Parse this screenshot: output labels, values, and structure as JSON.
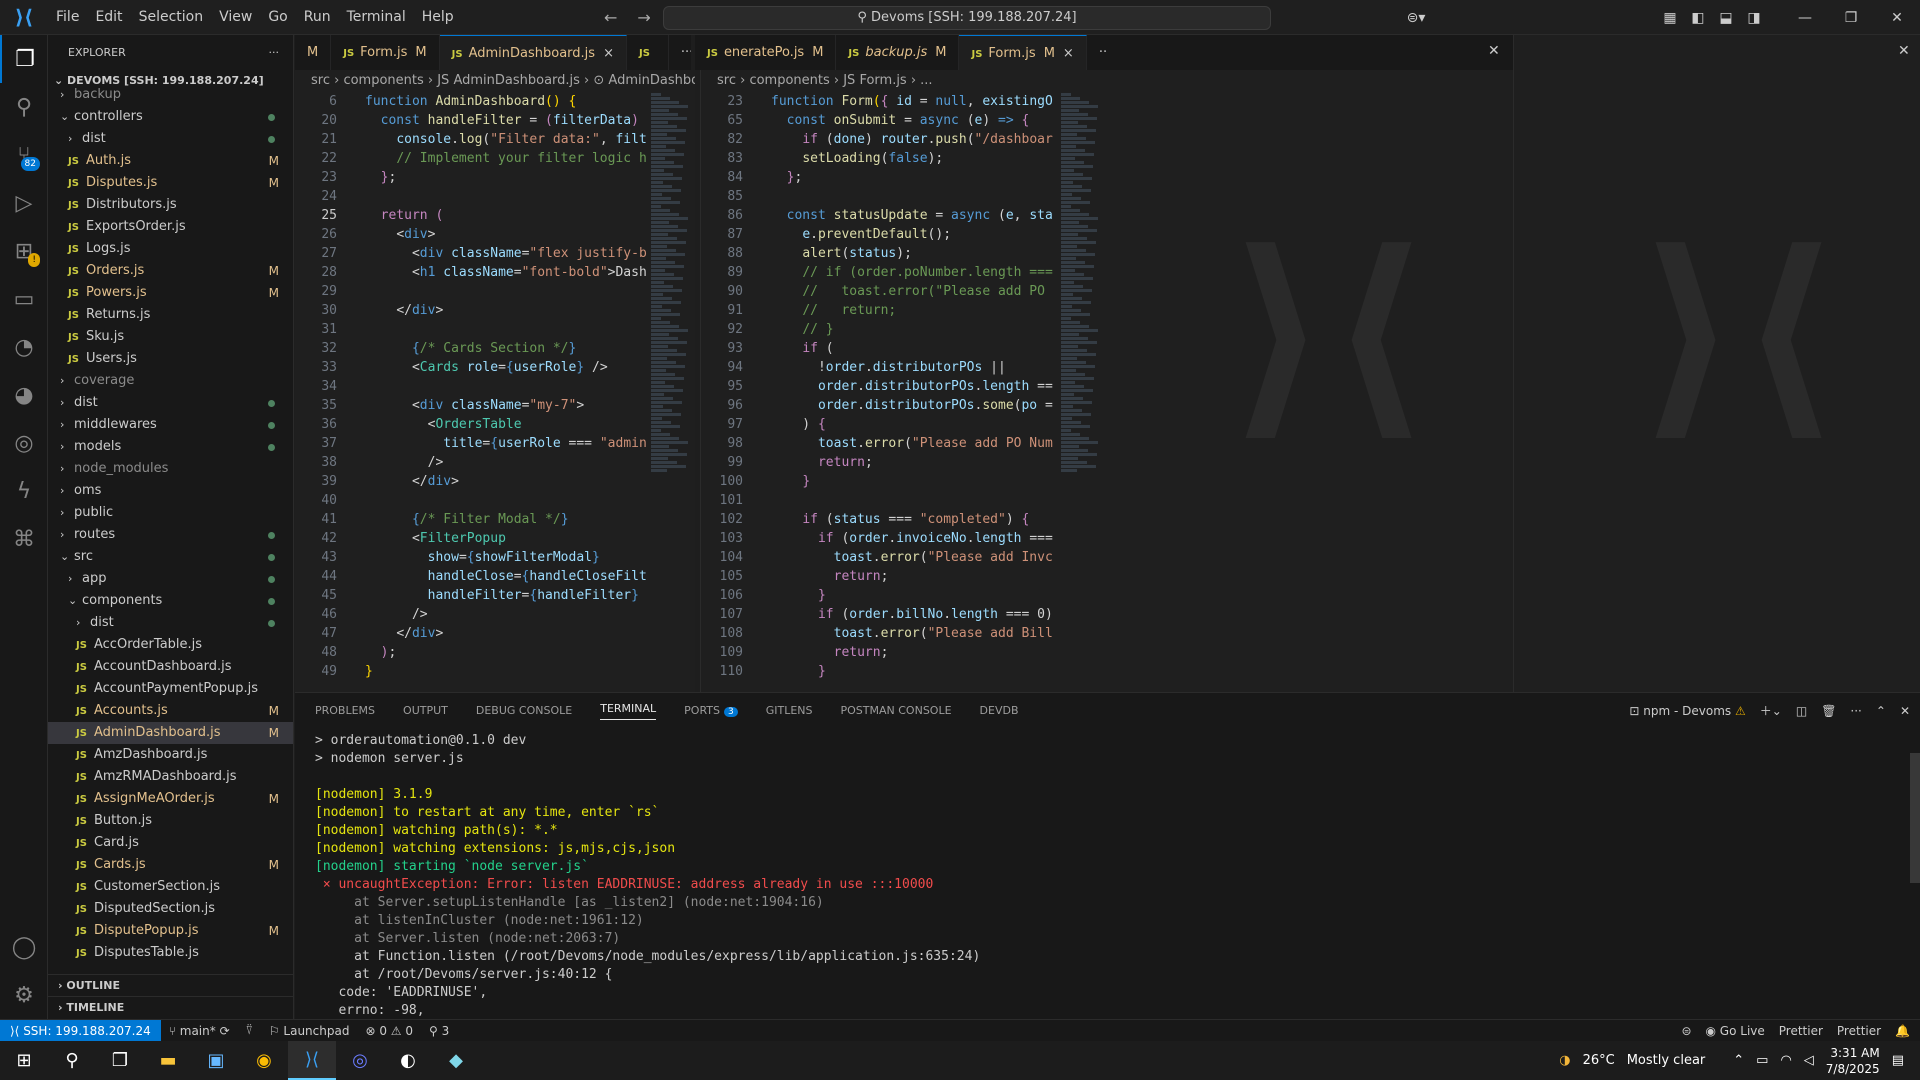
{
  "titlebar": {
    "menu": [
      "File",
      "Edit",
      "Selection",
      "View",
      "Go",
      "Run",
      "Terminal",
      "Help"
    ],
    "search": "Devoms [SSH: 199.188.207.24]"
  },
  "activity": {
    "scm_badge": "82"
  },
  "explorer": {
    "title": "EXPLORER",
    "root": "DEVOMS [SSH: 199.188.207.24]",
    "more": "···",
    "rows": [
      {
        "indent": 1,
        "name": "backup",
        "type": "folder",
        "state": "dim"
      },
      {
        "indent": 1,
        "name": "controllers",
        "type": "folder-open",
        "dot": true
      },
      {
        "indent": 2,
        "name": "dist",
        "type": "folder",
        "dot": true
      },
      {
        "indent": 2,
        "name": "Auth.js",
        "type": "js",
        "m": "M",
        "state": "mod"
      },
      {
        "indent": 2,
        "name": "Disputes.js",
        "type": "js",
        "m": "M",
        "state": "mod"
      },
      {
        "indent": 2,
        "name": "Distributors.js",
        "type": "js"
      },
      {
        "indent": 2,
        "name": "ExportsOrder.js",
        "type": "js"
      },
      {
        "indent": 2,
        "name": "Logs.js",
        "type": "js"
      },
      {
        "indent": 2,
        "name": "Orders.js",
        "type": "js",
        "m": "M",
        "state": "mod"
      },
      {
        "indent": 2,
        "name": "Powers.js",
        "type": "js",
        "m": "M",
        "state": "mod"
      },
      {
        "indent": 2,
        "name": "Returns.js",
        "type": "js"
      },
      {
        "indent": 2,
        "name": "Sku.js",
        "type": "js"
      },
      {
        "indent": 2,
        "name": "Users.js",
        "type": "js"
      },
      {
        "indent": 1,
        "name": "coverage",
        "type": "folder",
        "state": "dim"
      },
      {
        "indent": 1,
        "name": "dist",
        "type": "folder",
        "dot": true
      },
      {
        "indent": 1,
        "name": "middlewares",
        "type": "folder",
        "dot": true
      },
      {
        "indent": 1,
        "name": "models",
        "type": "folder",
        "dot": true
      },
      {
        "indent": 1,
        "name": "node_modules",
        "type": "folder",
        "state": "dim"
      },
      {
        "indent": 1,
        "name": "oms",
        "type": "folder"
      },
      {
        "indent": 1,
        "name": "public",
        "type": "folder"
      },
      {
        "indent": 1,
        "name": "routes",
        "type": "folder",
        "dot": true
      },
      {
        "indent": 1,
        "name": "src",
        "type": "folder-open",
        "dot": true
      },
      {
        "indent": 2,
        "name": "app",
        "type": "folder",
        "dot": true
      },
      {
        "indent": 2,
        "name": "components",
        "type": "folder-open",
        "dot": true
      },
      {
        "indent": 3,
        "name": "dist",
        "type": "folder",
        "dot": true
      },
      {
        "indent": 3,
        "name": "AccOrderTable.js",
        "type": "js"
      },
      {
        "indent": 3,
        "name": "AccountDashboard.js",
        "type": "js"
      },
      {
        "indent": 3,
        "name": "AccountPaymentPopup.js",
        "type": "js"
      },
      {
        "indent": 3,
        "name": "Accounts.js",
        "type": "js",
        "m": "M",
        "state": "mod"
      },
      {
        "indent": 3,
        "name": "AdminDashboard.js",
        "type": "js",
        "m": "M",
        "state": "sel"
      },
      {
        "indent": 3,
        "name": "AmzDashboard.js",
        "type": "js"
      },
      {
        "indent": 3,
        "name": "AmzRMADashboard.js",
        "type": "js"
      },
      {
        "indent": 3,
        "name": "AssignMeAOrder.js",
        "type": "js",
        "m": "M",
        "state": "mod"
      },
      {
        "indent": 3,
        "name": "Button.js",
        "type": "js"
      },
      {
        "indent": 3,
        "name": "Card.js",
        "type": "js"
      },
      {
        "indent": 3,
        "name": "Cards.js",
        "type": "js",
        "m": "M",
        "state": "mod"
      },
      {
        "indent": 3,
        "name": "CustomerSection.js",
        "type": "js"
      },
      {
        "indent": 3,
        "name": "DisputedSection.js",
        "type": "js"
      },
      {
        "indent": 3,
        "name": "DisputePopup.js",
        "type": "js",
        "m": "M",
        "state": "mod"
      },
      {
        "indent": 3,
        "name": "DisputesTable.js",
        "type": "js"
      }
    ],
    "outline": "OUTLINE",
    "timeline": "TIMELINE"
  },
  "tabs_left": [
    {
      "label": "M",
      "partial": true
    },
    {
      "label": "Form.js",
      "m": "M"
    },
    {
      "label": "AdminDashboard.js",
      "close": "×",
      "active": true
    },
    {
      "label": "",
      "js": true
    },
    {
      "label": "···"
    }
  ],
  "tabs_right": [
    {
      "label": "eneratePo.js",
      "m": "M"
    },
    {
      "label": "backup.js",
      "m": "M",
      "italic": true
    },
    {
      "label": "Form.js",
      "m": "M",
      "close": "×",
      "active": true
    },
    {
      "label": "···"
    }
  ],
  "editor_left": {
    "breadcrumb": "src › components › JS AdminDashboard.js › ⊙ AdminDashboard",
    "lines": [
      {
        "n": "6",
        "html": "<span class='kw'>function</span> <span class='fn'>AdminDashboard</span><span class='br'>()</span> <span class='br'>{</span>"
      },
      {
        "n": "20",
        "html": "  <span class='kw'>const</span> <span class='fn'>handleFilter</span> <span class='pl'>=</span> <span class='kw2'>(</span><span class='vr'>filterData</span><span class='kw2'>)</span>"
      },
      {
        "n": "21",
        "html": "    <span class='vr'>console</span>.<span class='fn'>log</span>(<span class='str'>\"Filter data:\"</span>, <span class='vr'>filt</span>"
      },
      {
        "n": "22",
        "html": "    <span class='cm'>// Implement your filter logic h</span>"
      },
      {
        "n": "23",
        "html": "  <span class='kw2'>}</span>;"
      },
      {
        "n": "24",
        "html": ""
      },
      {
        "n": "25",
        "html": "  <span class='kw2'>return</span> <span class='kw2'>(</span>",
        "cur": true
      },
      {
        "n": "26",
        "html": "    <span class='pl'>&lt;</span><span class='kw'>div</span><span class='pl'>&gt;</span>"
      },
      {
        "n": "27",
        "html": "      <span class='pl'>&lt;</span><span class='kw'>div</span> <span class='at'>className</span>=<span class='str'>\"flex justify-b</span>"
      },
      {
        "n": "28",
        "html": "      <span class='pl'>&lt;</span><span class='kw'>h1</span> <span class='at'>className</span>=<span class='str'>\"font-bold\"</span>&gt;Dash"
      },
      {
        "n": "29",
        "html": ""
      },
      {
        "n": "30",
        "html": "    <span class='pl'>&lt;/</span><span class='kw'>div</span><span class='pl'>&gt;</span>"
      },
      {
        "n": "31",
        "html": ""
      },
      {
        "n": "32",
        "html": "      <span class='kw'>{</span><span class='cm'>/* Cards Section */</span><span class='kw'>}</span>"
      },
      {
        "n": "33",
        "html": "      <span class='pl'>&lt;</span><span class='tg'>Cards</span> <span class='at'>role</span>=<span class='kw'>{</span><span class='vr'>userRole</span><span class='kw'>}</span> <span class='pl'>/&gt;</span>"
      },
      {
        "n": "34",
        "html": ""
      },
      {
        "n": "35",
        "html": "      <span class='pl'>&lt;</span><span class='kw'>div</span> <span class='at'>className</span>=<span class='str'>\"my-7\"</span><span class='pl'>&gt;</span>"
      },
      {
        "n": "36",
        "html": "        <span class='pl'>&lt;</span><span class='tg'>OrdersTable</span>"
      },
      {
        "n": "37",
        "html": "          <span class='at'>title</span>=<span class='kw'>{</span><span class='vr'>userRole</span> === <span class='str'>\"admin</span>"
      },
      {
        "n": "38",
        "html": "        <span class='pl'>/&gt;</span>"
      },
      {
        "n": "39",
        "html": "      <span class='pl'>&lt;/</span><span class='kw'>div</span><span class='pl'>&gt;</span>"
      },
      {
        "n": "40",
        "html": ""
      },
      {
        "n": "41",
        "html": "      <span class='kw'>{</span><span class='cm'>/* Filter Modal */</span><span class='kw'>}</span>"
      },
      {
        "n": "42",
        "html": "      <span class='pl'>&lt;</span><span class='tg'>FilterPopup</span>"
      },
      {
        "n": "43",
        "html": "        <span class='at'>show</span>=<span class='kw'>{</span><span class='vr'>showFilterModal</span><span class='kw'>}</span>"
      },
      {
        "n": "44",
        "html": "        <span class='at'>handleClose</span>=<span class='kw'>{</span><span class='vr'>handleCloseFilt</span>"
      },
      {
        "n": "45",
        "html": "        <span class='at'>handleFilter</span>=<span class='kw'>{</span><span class='vr'>handleFilter</span><span class='kw'>}</span>"
      },
      {
        "n": "46",
        "html": "      <span class='pl'>/&gt;</span>"
      },
      {
        "n": "47",
        "html": "    <span class='pl'>&lt;/</span><span class='kw'>div</span><span class='pl'>&gt;</span>"
      },
      {
        "n": "48",
        "html": "  <span class='kw2'>)</span>;"
      },
      {
        "n": "49",
        "html": "<span class='br'>}</span>"
      }
    ]
  },
  "editor_right": {
    "breadcrumb": "src › components › JS Form.js › ...",
    "lines": [
      {
        "n": "23",
        "html": "<span class='kw'>function</span> <span class='fn'>Form</span><span class='br'>(</span><span class='kw2'>{</span> <span class='vr'>id</span> = <span class='kw'>null</span>, <span class='vr'>existingO</span>"
      },
      {
        "n": "65",
        "html": "  <span class='kw'>const</span> <span class='fn'>onSubmit</span> = <span class='kw'>async</span> (<span class='vr'>e</span>) <span class='kw'>=&gt;</span> <span class='kw2'>{</span>"
      },
      {
        "n": "82",
        "html": "    <span class='kw2'>if</span> (<span class='vr'>done</span>) <span class='vr'>router</span>.<span class='fn'>push</span>(<span class='str'>\"/dashboar</span>"
      },
      {
        "n": "83",
        "html": "    <span class='fn'>setLoading</span>(<span class='kw'>false</span>);"
      },
      {
        "n": "84",
        "html": "  <span class='kw2'>}</span>;"
      },
      {
        "n": "85",
        "html": ""
      },
      {
        "n": "86",
        "html": "  <span class='kw'>const</span> <span class='fn'>statusUpdate</span> = <span class='kw'>async</span> (<span class='vr'>e</span>, <span class='vr'>sta</span>"
      },
      {
        "n": "87",
        "html": "    <span class='vr'>e</span>.<span class='fn'>preventDefault</span>();"
      },
      {
        "n": "88",
        "html": "    <span class='fn'>alert</span>(<span class='vr'>status</span>);"
      },
      {
        "n": "89",
        "html": "    <span class='cm'>// if (order.poNumber.length ===</span>"
      },
      {
        "n": "90",
        "html": "    <span class='cm'>//   toast.error(\"Please add PO</span>"
      },
      {
        "n": "91",
        "html": "    <span class='cm'>//   return;</span>"
      },
      {
        "n": "92",
        "html": "    <span class='cm'>// }</span>"
      },
      {
        "n": "93",
        "html": "    <span class='kw2'>if</span> ("
      },
      {
        "n": "94",
        "html": "      !<span class='vr'>order</span>.<span class='vr'>distributorPOs</span> ||"
      },
      {
        "n": "95",
        "html": "      <span class='vr'>order</span>.<span class='vr'>distributorPOs</span>.<span class='vr'>length</span> =="
      },
      {
        "n": "96",
        "html": "      <span class='vr'>order</span>.<span class='vr'>distributorPOs</span>.<span class='fn'>some</span>(<span class='vr'>po</span> ="
      },
      {
        "n": "97",
        "html": "    ) <span class='kw2'>{</span>"
      },
      {
        "n": "98",
        "html": "      <span class='vr'>toast</span>.<span class='fn'>error</span>(<span class='str'>\"Please add PO Num</span>"
      },
      {
        "n": "99",
        "html": "      <span class='kw2'>return</span>;"
      },
      {
        "n": "100",
        "html": "    <span class='kw2'>}</span>"
      },
      {
        "n": "101",
        "html": ""
      },
      {
        "n": "102",
        "html": "    <span class='kw2'>if</span> (<span class='vr'>status</span> === <span class='str'>\"completed\"</span>) <span class='kw2'>{</span>"
      },
      {
        "n": "103",
        "html": "      <span class='kw2'>if</span> (<span class='vr'>order</span>.<span class='vr'>invoiceNo</span>.<span class='vr'>length</span> ==="
      },
      {
        "n": "104",
        "html": "        <span class='vr'>toast</span>.<span class='fn'>error</span>(<span class='str'>\"Please add Invc</span>"
      },
      {
        "n": "105",
        "html": "        <span class='kw2'>return</span>;"
      },
      {
        "n": "106",
        "html": "      <span class='kw2'>}</span>"
      },
      {
        "n": "107",
        "html": "      <span class='kw2'>if</span> (<span class='vr'>order</span>.<span class='vr'>billNo</span>.<span class='vr'>length</span> === 0)"
      },
      {
        "n": "108",
        "html": "        <span class='vr'>toast</span>.<span class='fn'>error</span>(<span class='str'>\"Please add Bill</span>"
      },
      {
        "n": "109",
        "html": "        <span class='kw2'>return</span>;"
      },
      {
        "n": "110",
        "html": "      <span class='kw2'>}</span>"
      }
    ]
  },
  "panel": {
    "tabs": [
      "PROBLEMS",
      "OUTPUT",
      "DEBUG CONSOLE",
      "TERMINAL",
      "PORTS",
      "GITLENS",
      "POSTMAN CONSOLE",
      "DEVDB"
    ],
    "active": "TERMINAL",
    "ports_badge": "3",
    "terminal_name": "npm - Devoms",
    "lines": [
      {
        "c": "",
        "t": "> orderautomation@0.1.0 dev"
      },
      {
        "c": "",
        "t": "> nodemon server.js"
      },
      {
        "c": "",
        "t": ""
      },
      {
        "c": "y",
        "t": "[nodemon] 3.1.9"
      },
      {
        "c": "y",
        "t": "[nodemon] to restart at any time, enter `rs`"
      },
      {
        "c": "y",
        "t": "[nodemon] watching path(s): *.*"
      },
      {
        "c": "y",
        "t": "[nodemon] watching extensions: js,mjs,cjs,json"
      },
      {
        "c": "g",
        "t": "[nodemon] starting `node server.js`"
      },
      {
        "c": "err",
        "t": " × uncaughtException: Error: listen EADDRINUSE: address already in use :::10000"
      },
      {
        "c": "dim2",
        "t": "     at Server.setupListenHandle [as _listen2] (node:net:1904:16)"
      },
      {
        "c": "dim2",
        "t": "     at listenInCluster (node:net:1961:12)"
      },
      {
        "c": "dim2",
        "t": "     at Server.listen (node:net:2063:7)"
      },
      {
        "c": "",
        "t": "     at Function.listen (/root/Devoms/node_modules/express/lib/application.js:635:24)"
      },
      {
        "c": "",
        "t": "     at /root/Devoms/server.js:40:12 {"
      },
      {
        "c": "",
        "t": "   code: 'EADDRINUSE',"
      },
      {
        "c": "",
        "t": "   errno: -98,"
      }
    ]
  },
  "status": {
    "remote": "SSH: 199.188.207.24",
    "branch": "main*",
    "launchpad": "Launchpad",
    "problems": "⊗ 0 ⚠ 0",
    "ports": "⚲ 3",
    "golive": "Go Live",
    "prettier1": "Prettier",
    "prettier2": "Prettier"
  },
  "taskbar": {
    "weather": "26°C",
    "weather_desc": "Mostly clear",
    "time": "3:31 AM",
    "date": "7/8/2025"
  }
}
